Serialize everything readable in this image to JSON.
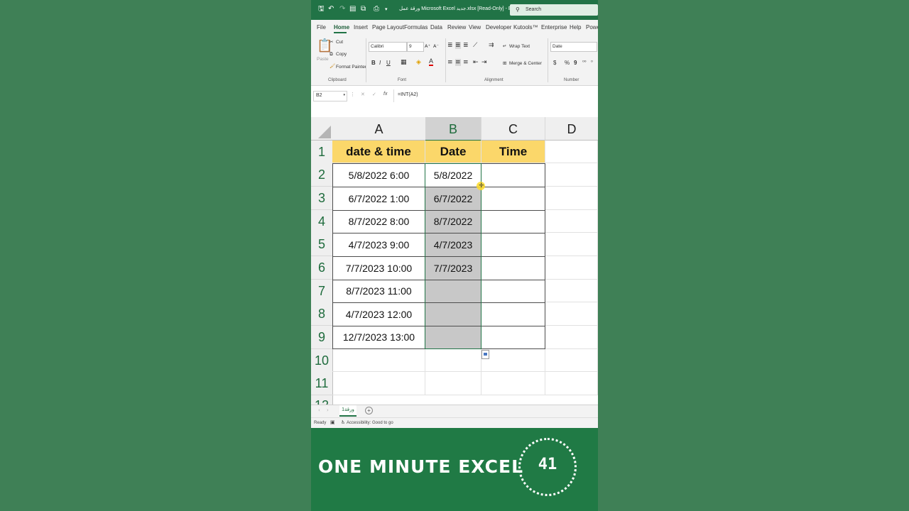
{
  "window": {
    "title": "ورقة عمل Microsoft Excel جديد.xlsx [Read-Only] - Excel",
    "search_placeholder": "Search"
  },
  "ribbon_tabs": [
    "File",
    "Home",
    "Insert",
    "Page Layout",
    "Formulas",
    "Data",
    "Review",
    "View",
    "Developer",
    "Kutools™",
    "Enterprise",
    "Help",
    "Power"
  ],
  "active_tab": "Home",
  "clipboard": {
    "paste": "Paste",
    "cut": "Cut",
    "copy": "Copy",
    "format_painter": "Format Painter",
    "label": "Clipboard"
  },
  "font": {
    "name": "Calibri",
    "size": "9",
    "label": "Font",
    "bold": "B",
    "italic": "I",
    "underline": "U"
  },
  "alignment": {
    "wrap_text": "Wrap Text",
    "merge_center": "Merge & Center",
    "label": "Alignment"
  },
  "number": {
    "format": "Date",
    "label": "Number",
    "currency": "$",
    "percent": "%",
    "comma": "9"
  },
  "formula_bar": {
    "name_box": "B2",
    "formula": "=INT(A2)",
    "fx": "fx"
  },
  "columns": [
    "A",
    "B",
    "C",
    "D"
  ],
  "rows": [
    "1",
    "2",
    "3",
    "4",
    "5",
    "6",
    "7",
    "8",
    "9",
    "10",
    "11",
    "12"
  ],
  "headers": {
    "a": "date & time",
    "b": "Date",
    "c": "Time"
  },
  "col_a": [
    "5/8/2022 6:00",
    "6/7/2022 1:00",
    "8/7/2022 8:00",
    "4/7/2023 9:00",
    "7/7/2023 10:00",
    "8/7/2023 11:00",
    "4/7/2023 12:00",
    "12/7/2023 13:00"
  ],
  "col_b": [
    "5/8/2022",
    "6/7/2022",
    "8/7/2022",
    "4/7/2023",
    "7/7/2023",
    "",
    "",
    ""
  ],
  "sheet_tab": "ورقة1",
  "status": {
    "ready": "Ready",
    "accessibility": "Accessibility: Good to go"
  },
  "banner": {
    "title": "ONE MINUTE EXCEL",
    "timer": "41"
  },
  "colors": {
    "excel_green": "#217346",
    "header_fill": "#fbd76a",
    "background": "#3f8056",
    "banner": "#207a45"
  }
}
